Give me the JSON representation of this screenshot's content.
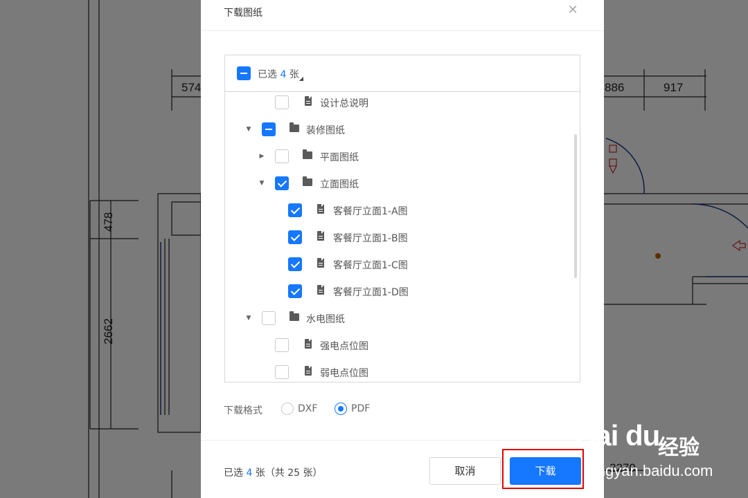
{
  "background": {
    "dimensions": [
      "574",
      "886",
      "917",
      "478",
      "2662",
      "2270"
    ]
  },
  "dialog": {
    "title": "下载图纸",
    "close_icon": "close-icon",
    "selection_header": {
      "prefix": "已选",
      "count": "4",
      "suffix": "张"
    },
    "tree": [
      {
        "label": "设计总说明",
        "type": "file",
        "state": "unchecked"
      },
      {
        "label": "装修图纸",
        "type": "folder",
        "state": "partial",
        "expanded": true
      },
      {
        "label": "平面图纸",
        "type": "folder",
        "state": "unchecked",
        "expanded": false
      },
      {
        "label": "立面图纸",
        "type": "folder",
        "state": "checked",
        "expanded": true
      },
      {
        "label": "客餐厅立面1-A图",
        "type": "file",
        "state": "checked"
      },
      {
        "label": "客餐厅立面1-B图",
        "type": "file",
        "state": "checked"
      },
      {
        "label": "客餐厅立面1-C图",
        "type": "file",
        "state": "checked"
      },
      {
        "label": "客餐厅立面1-D图",
        "type": "file",
        "state": "checked"
      },
      {
        "label": "水电图纸",
        "type": "folder",
        "state": "unchecked",
        "expanded": true
      },
      {
        "label": "强电点位图",
        "type": "file",
        "state": "unchecked"
      },
      {
        "label": "弱电点位图",
        "type": "file",
        "state": "unchecked"
      }
    ],
    "format": {
      "label": "下载格式",
      "options": [
        "DXF",
        "PDF"
      ],
      "selected": "PDF"
    },
    "footer": {
      "count_prefix": "已选",
      "count": "4",
      "count_suffix": "张（共 25 张）",
      "cancel_label": "取消",
      "download_label": "下载"
    }
  },
  "watermark": {
    "logo": "Bai du",
    "cn": "经验",
    "url": "jingyan.baidu.com"
  },
  "colors": {
    "accent": "#1677ff",
    "highlight": "#e60000"
  }
}
